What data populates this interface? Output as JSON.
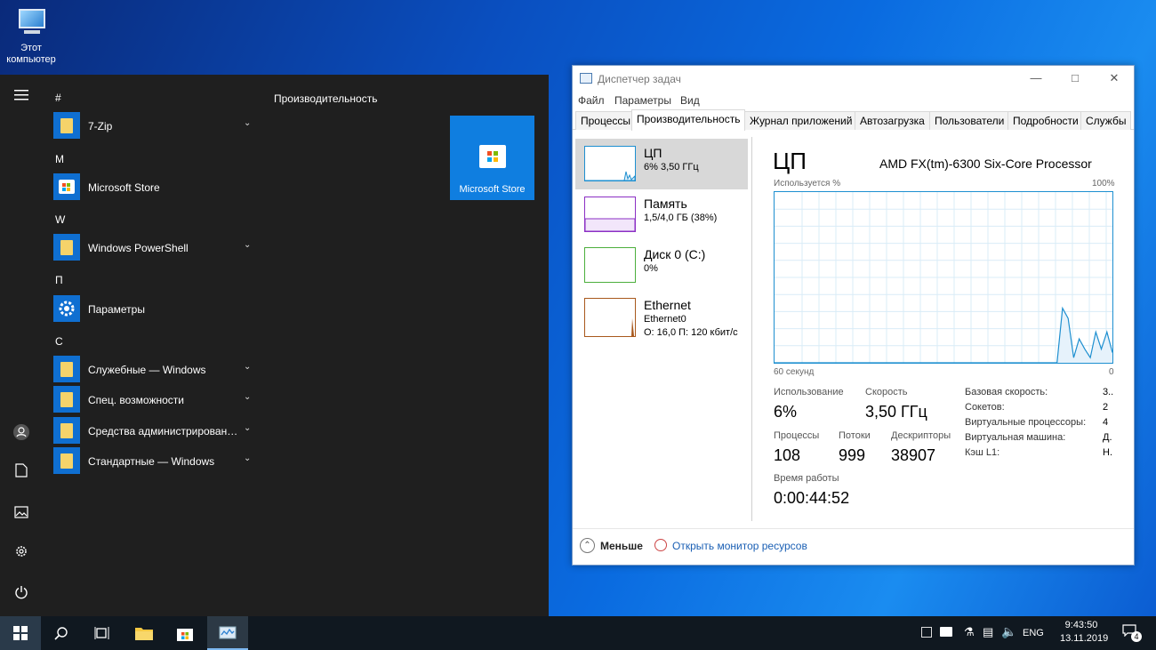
{
  "desktop": {
    "icon_label": "Этот компьютер"
  },
  "start_menu": {
    "groups": [
      {
        "letter": "#",
        "apps": [
          {
            "label": "7-Zip",
            "chevron": true
          }
        ]
      },
      {
        "letter": "M",
        "apps": [
          {
            "label": "Microsoft Store",
            "chevron": false
          }
        ]
      },
      {
        "letter": "W",
        "apps": [
          {
            "label": "Windows PowerShell",
            "chevron": true
          }
        ]
      },
      {
        "letter": "П",
        "apps": [
          {
            "label": "Параметры",
            "chevron": false
          }
        ]
      },
      {
        "letter": "С",
        "apps": [
          {
            "label": "Служебные — Windows",
            "chevron": true
          },
          {
            "label": "Спец. возможности",
            "chevron": true
          },
          {
            "label": "Средства администрирования...",
            "chevron": true
          },
          {
            "label": "Стандартные — Windows",
            "chevron": true
          }
        ]
      }
    ],
    "tiles_section": "Производительность",
    "tile_label": "Microsoft Store"
  },
  "task_manager": {
    "title": "Диспетчер задач",
    "menu": [
      "Файл",
      "Параметры",
      "Вид"
    ],
    "tabs": [
      "Процессы",
      "Производительность",
      "Журнал приложений",
      "Автозагрузка",
      "Пользователи",
      "Подробности",
      "Службы"
    ],
    "active_tab": "Производительность",
    "sidebar": [
      {
        "name": "ЦП",
        "line1": "6%  3,50 ГГц",
        "line2": "",
        "color": "#1d8fd0"
      },
      {
        "name": "Память",
        "line1": "1,5/4,0 ГБ (38%)",
        "line2": "",
        "color": "#8b2fc4"
      },
      {
        "name": "Диск 0 (C:)",
        "line1": "0%",
        "line2": "",
        "color": "#4caf3c"
      },
      {
        "name": "Ethernet",
        "line1": "Ethernet0",
        "line2": "О: 16,0 П: 120 кбит/с",
        "color": "#a8581c"
      }
    ],
    "cpu": {
      "title": "ЦП",
      "model": "AMD FX(tm)-6300 Six-Core Processor",
      "graph_label": "Используется %",
      "graph_max": "100%",
      "graph_time": "60 секунд",
      "graph_min": "0",
      "usage_points": [
        0,
        0,
        0,
        0,
        0,
        0,
        0,
        0,
        0,
        0,
        0,
        0,
        0,
        0,
        0,
        0,
        0,
        0,
        0,
        0,
        0,
        0,
        0,
        0,
        0,
        0,
        0,
        0,
        0,
        0,
        0,
        0,
        0,
        0,
        0,
        0,
        0,
        0,
        0,
        0,
        0,
        0,
        0,
        0,
        0,
        0,
        0,
        0,
        0,
        0,
        0,
        0,
        32,
        26,
        3,
        14,
        8,
        3,
        18,
        8,
        18,
        6
      ],
      "stats": {
        "usage_label": "Использование",
        "usage": "6%",
        "speed_label": "Скорость",
        "speed": "3,50 ГГц",
        "processes_label": "Процессы",
        "processes": "108",
        "threads_label": "Потоки",
        "threads": "999",
        "handles_label": "Дескрипторы",
        "handles": "38907",
        "uptime_label": "Время работы",
        "uptime": "0:00:44:52"
      },
      "specs": [
        {
          "label": "Базовая скорость:",
          "value": "3.."
        },
        {
          "label": "Сокетов:",
          "value": "2"
        },
        {
          "label": "Виртуальные процессоры:",
          "value": "4"
        },
        {
          "label": "Виртуальная машина:",
          "value": "Д."
        },
        {
          "label": "Кэш L1:",
          "value": "Н."
        }
      ]
    },
    "less_label": "Меньше",
    "monitor_link": "Открыть монитор ресурсов"
  },
  "taskbar": {
    "lang": "ENG",
    "time": "9:43:50",
    "date": "13.11.2019",
    "notif_count": "4"
  }
}
